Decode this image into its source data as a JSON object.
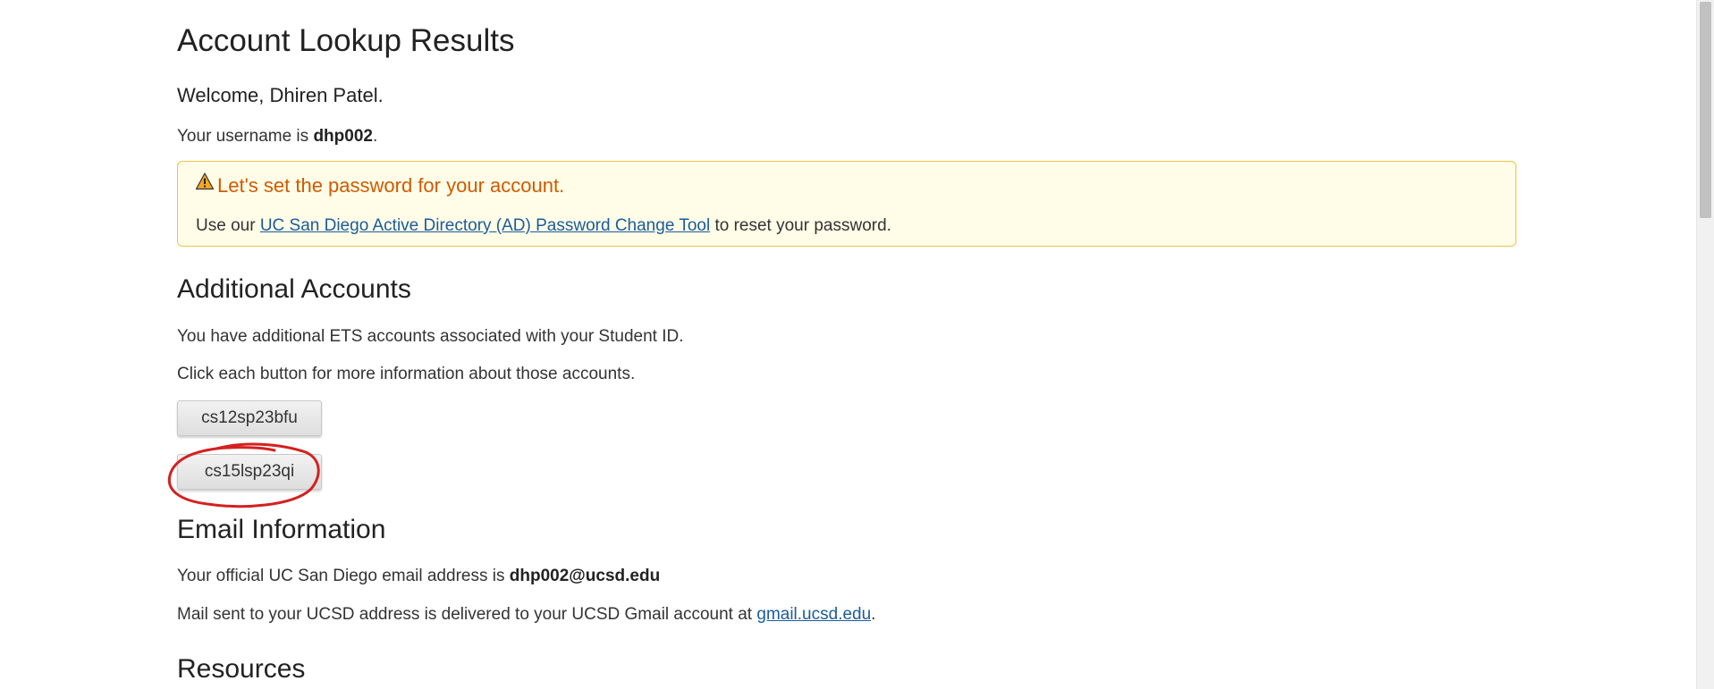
{
  "page": {
    "title": "Account Lookup Results",
    "welcome": "Welcome, Dhiren Patel."
  },
  "username": {
    "prefix": "Your username is ",
    "value": "dhp002",
    "suffix": "."
  },
  "alert": {
    "icon": "warning-triangle-icon",
    "title": "Let's set the password for your account.",
    "body_prefix": "Use our ",
    "link_text": "UC San Diego Active Directory (AD) Password Change Tool",
    "body_suffix": " to reset your password.",
    "title_color": "#d05a00",
    "background": "#fffde8",
    "border_color": "#f0c24a"
  },
  "additional_accounts": {
    "heading": "Additional Accounts",
    "line1": "You have additional ETS accounts associated with your Student ID.",
    "line2": "Click each button for more information about those accounts.",
    "buttons": [
      "cs12sp23bfu",
      "cs15lsp23qi"
    ],
    "highlight_color": "#d42020"
  },
  "email": {
    "heading": "Email Information",
    "line1_prefix": "Your official UC San Diego email address is ",
    "address": "dhp002@ucsd.edu",
    "line2_prefix": "Mail sent to your UCSD address is delivered to your UCSD Gmail account at ",
    "gmail_link": "gmail.ucsd.edu",
    "line2_suffix": "."
  },
  "resources": {
    "heading": "Resources"
  },
  "colors": {
    "link": "#1b5c99",
    "text": "#333333"
  }
}
